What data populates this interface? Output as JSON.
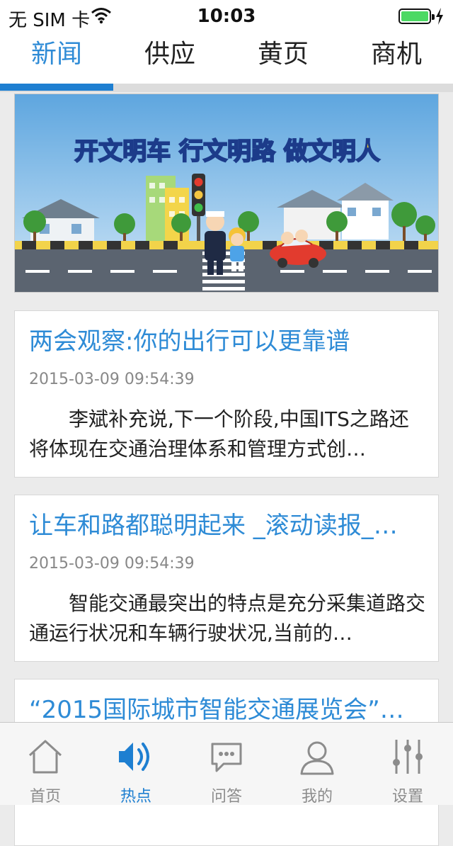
{
  "status_bar": {
    "carrier": "无 SIM 卡",
    "time": "10:03"
  },
  "top_tabs": [
    {
      "label": "新闻",
      "active": true
    },
    {
      "label": "供应",
      "active": false
    },
    {
      "label": "黄页",
      "active": false
    },
    {
      "label": "商机",
      "active": false
    }
  ],
  "banner": {
    "slogan": "开文明车 行文明路 做文明人"
  },
  "news": [
    {
      "title": "两会观察:你的出行可以更靠谱",
      "date": "2015-03-09 09:54:39",
      "summary": "李斌补充说,下一个阶段,中国ITS之路还将体现在交通治理体系和管理方式创…"
    },
    {
      "title": "让车和路都聪明起来 _滚动读报_…",
      "date": "2015-03-09 09:54:39",
      "summary": "智能交通最突出的特点是充分采集道路交通运行状况和车辆行驶状况,当前的…"
    },
    {
      "title": "“2015国际城市智能交通展览会”…",
      "date": "",
      "summary": ""
    }
  ],
  "bottom_nav": [
    {
      "label": "首页",
      "icon": "home-icon",
      "active": false
    },
    {
      "label": "热点",
      "icon": "hotspot-icon",
      "active": true
    },
    {
      "label": "问答",
      "icon": "qa-icon",
      "active": false
    },
    {
      "label": "我的",
      "icon": "profile-icon",
      "active": false
    },
    {
      "label": "设置",
      "icon": "settings-icon",
      "active": false
    }
  ],
  "colors": {
    "accent": "#1e7fd1",
    "title_blue": "#2e8bd6",
    "inactive": "#8c8c8c",
    "battery": "#4cd964"
  }
}
